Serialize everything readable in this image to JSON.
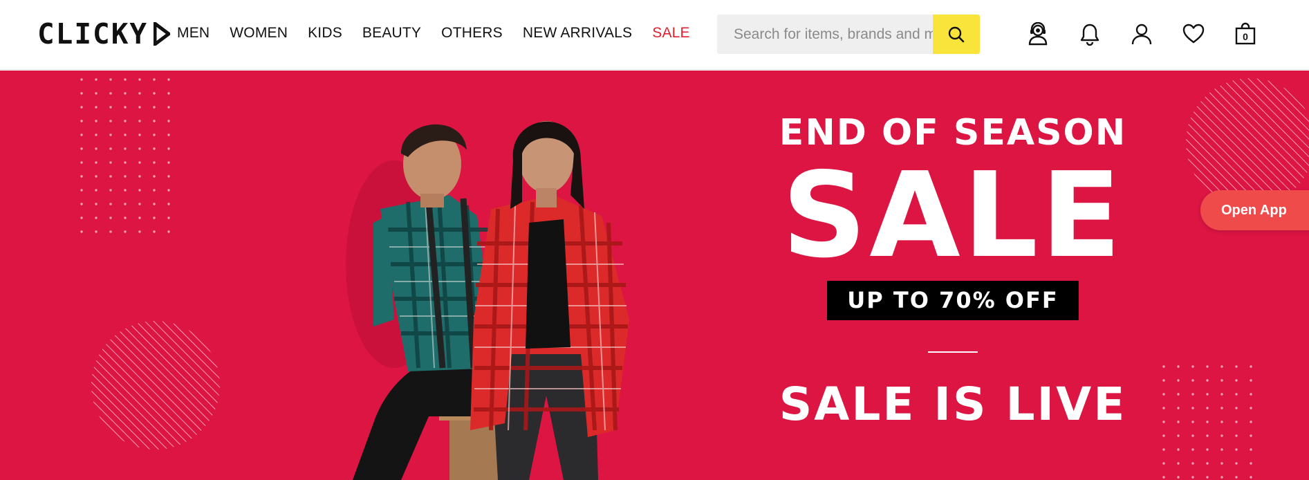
{
  "brand": {
    "logo_text": "CLICKY"
  },
  "nav": {
    "items": [
      "MEN",
      "WOMEN",
      "KIDS",
      "BEAUTY",
      "OTHERS",
      "NEW ARRIVALS",
      "SALE"
    ]
  },
  "search": {
    "placeholder": "Search for items, brands and more"
  },
  "header_icons": {
    "support": "support-agent-icon",
    "notifications": "bell-icon",
    "account": "user-icon",
    "wishlist": "heart-icon",
    "bag": "shopping-bag-icon",
    "bag_count": "0"
  },
  "hero": {
    "background_color": "#dc1543",
    "line1": "END OF SEASON",
    "line2": "SALE",
    "offer": "UP TO 70% OFF",
    "line3": "SALE IS LIVE"
  },
  "open_app": {
    "label": "Open App"
  },
  "colors": {
    "accent_sale": "#e01f30",
    "search_button": "#f8e43a",
    "open_app_button": "#ef4b4b"
  }
}
